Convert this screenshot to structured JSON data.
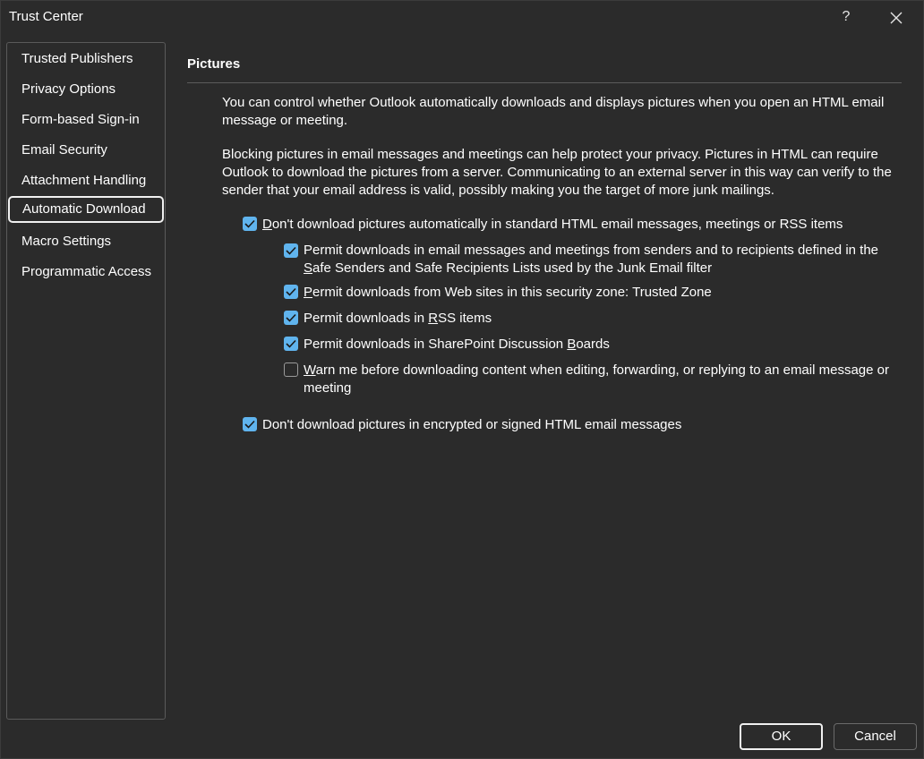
{
  "window": {
    "title": "Trust Center",
    "help_label": "?"
  },
  "sidebar": {
    "items": [
      {
        "label": "Trusted Publishers"
      },
      {
        "label": "Privacy Options"
      },
      {
        "label": "Form-based Sign-in"
      },
      {
        "label": "Email Security"
      },
      {
        "label": "Attachment Handling"
      },
      {
        "label": "Automatic Download",
        "selected": true
      },
      {
        "label": "Macro Settings"
      },
      {
        "label": "Programmatic Access"
      }
    ]
  },
  "main": {
    "section_title": "Pictures",
    "intro": "You can control whether Outlook automatically downloads and displays pictures when you open an HTML email message or meeting.",
    "privacy_note": "Blocking pictures in email messages and meetings can help protect your privacy. Pictures in HTML can require Outlook to download the pictures from a server. Communicating to an external server in this way can verify to the sender that your email address is valid, possibly making you the target of more junk mailings.",
    "options": {
      "dont_download": {
        "checked": true,
        "mnemonic": "D",
        "rest": "on't download pictures automatically in standard HTML email messages, meetings or RSS items"
      },
      "permit_safe_senders": {
        "checked": true,
        "line1": "Permit downloads in email messages and meetings from senders and to recipients defined in the",
        "mnemonic": "S",
        "line2_rest": "afe Senders and Safe Recipients Lists used by the Junk Email filter"
      },
      "permit_web_sites": {
        "checked": true,
        "mnemonic": "P",
        "rest": "ermit downloads from Web sites in this security zone: Trusted Zone"
      },
      "permit_rss": {
        "checked": true,
        "pre": "Permit downloads in ",
        "mnemonic": "R",
        "rest": "SS items"
      },
      "permit_sharepoint": {
        "checked": true,
        "pre": "Permit downloads in SharePoint Discussion ",
        "mnemonic": "B",
        "rest": "oards"
      },
      "warn_me": {
        "checked": false,
        "mnemonic": "W",
        "rest": "arn me before downloading content when editing, forwarding, or replying to an email message or",
        "line2": "meeting"
      },
      "dont_download_encrypted": {
        "checked": true,
        "label": "Don't download pictures in encrypted or signed HTML email messages"
      }
    }
  },
  "footer": {
    "ok_label": "OK",
    "cancel_label": "Cancel"
  },
  "colors": {
    "background": "#2b2b2b",
    "checkbox_accent": "#60b4ee",
    "text": "#ffffff"
  }
}
